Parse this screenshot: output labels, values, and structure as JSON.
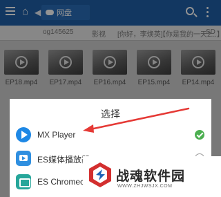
{
  "topbar": {
    "location_label": "网盘"
  },
  "tabs": [
    "og145625",
    "影视",
    "[你好，李焕英]",
    "【你是我的一天2...】",
    "SD"
  ],
  "files": [
    {
      "name": "EP18.mp4"
    },
    {
      "name": "EP17.mp4"
    },
    {
      "name": "EP16.mp4"
    },
    {
      "name": "EP15.mp4"
    },
    {
      "name": "EP14.mp4"
    }
  ],
  "dialog": {
    "title": "选择",
    "options": [
      {
        "label": "MX Player",
        "icon": "mx-player-icon",
        "selected": true
      },
      {
        "label": "ES媒体播放器",
        "icon": "es-media-player-icon",
        "selected": false
      },
      {
        "label": "ES Chromecast",
        "icon": "es-chromecast-icon",
        "selected": false
      }
    ]
  },
  "watermark": {
    "name": "战魂软件园",
    "url": "WWW.ZHJWSJX.COM"
  },
  "colors": {
    "topbar": "#1f5fa8",
    "arrow": "#e53935",
    "check": "#4caf50",
    "mx_blue": "#1e88e5"
  }
}
